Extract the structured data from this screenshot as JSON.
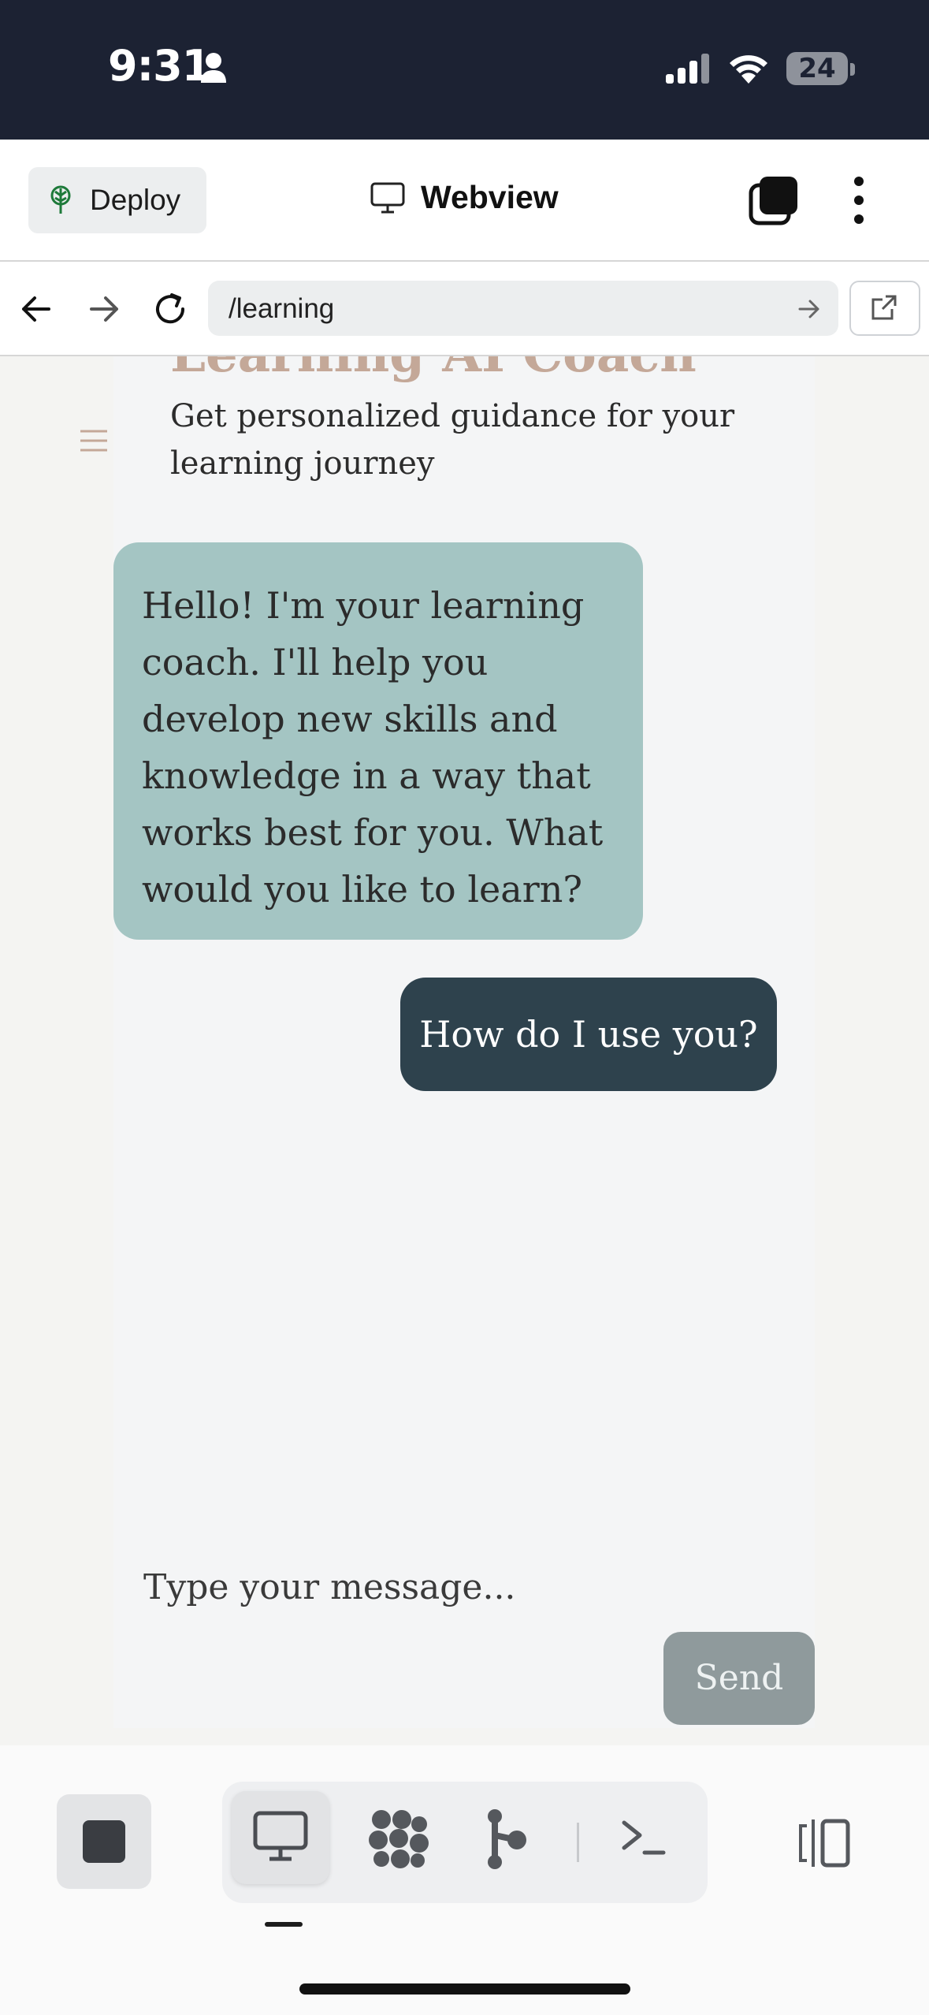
{
  "status_bar": {
    "time": "9:31",
    "battery": "24",
    "icons": [
      "person-icon",
      "signal-icon",
      "wifi-icon",
      "battery-icon"
    ]
  },
  "header": {
    "deploy_label": "Deploy",
    "title": "Webview",
    "icons": [
      "deploy-icon",
      "monitor-icon",
      "tabs-icon",
      "more-vertical-icon"
    ]
  },
  "url_bar": {
    "url": "/learning",
    "icons": [
      "back-arrow-icon",
      "forward-arrow-icon",
      "reload-icon",
      "go-arrow-icon",
      "open-external-icon"
    ]
  },
  "page": {
    "title": "Learning AI Coach",
    "subtitle": "Get personalized guidance for your learning journey",
    "messages": [
      {
        "role": "coach",
        "text": "Hello! I'm your learning coach. I'll help you develop new skills and knowledge in a way that works best for you. What would you like to learn?"
      },
      {
        "role": "user",
        "text": "How do I use you?"
      }
    ],
    "input_placeholder": "Type your message...",
    "send_label": "Send",
    "colors": {
      "coach_bubble": "#a4c5c3",
      "user_bubble": "#2e424d",
      "send_button": "#8f9a9c",
      "title": "#c4a898"
    }
  },
  "bottom_bar": {
    "icons": [
      "stop-icon",
      "webview-monitor-icon",
      "agent-icon",
      "git-icon",
      "shell-icon",
      "panels-icon"
    ]
  }
}
